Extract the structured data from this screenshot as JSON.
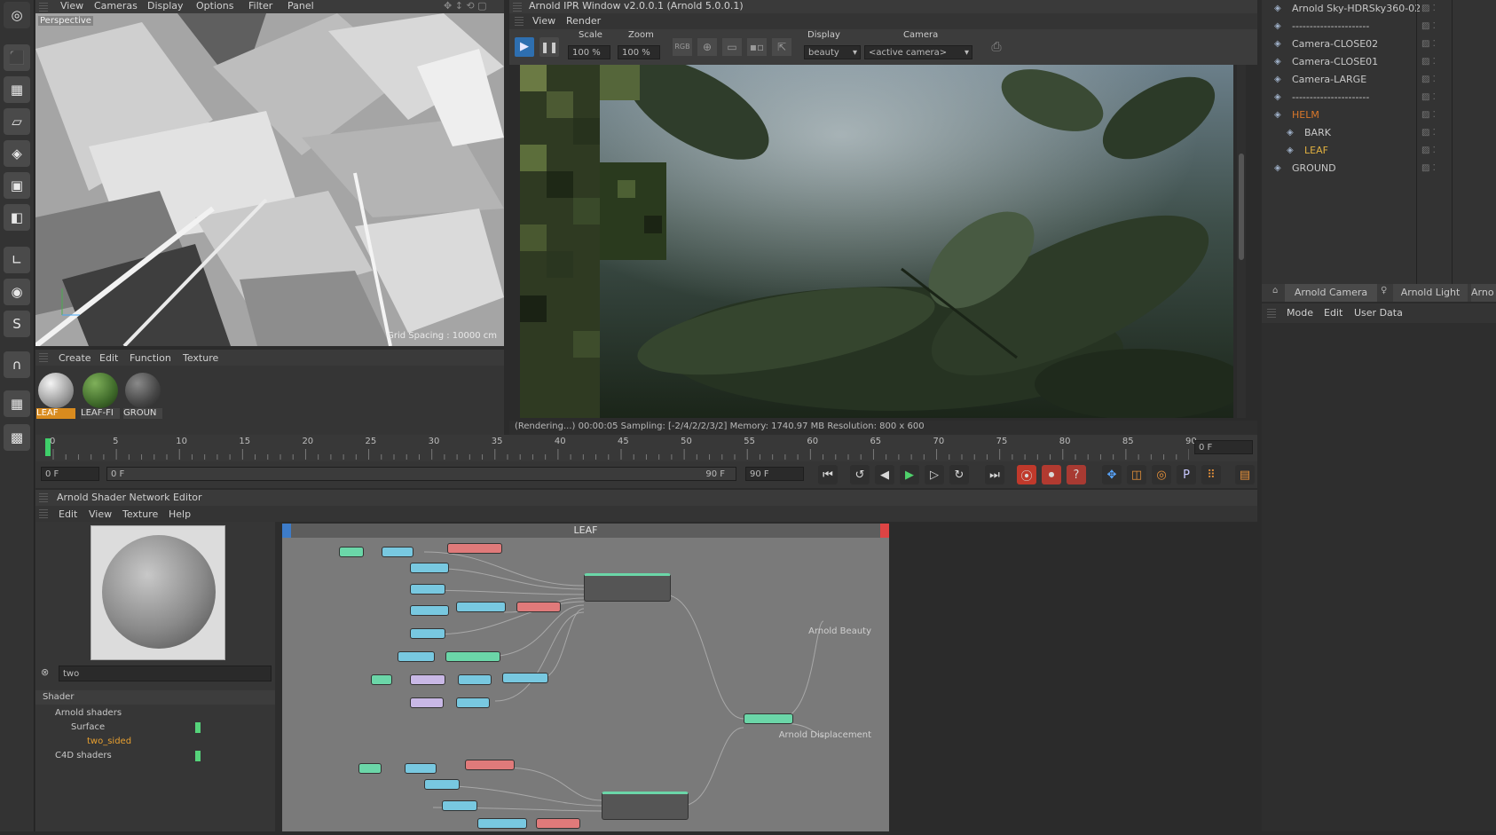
{
  "viewport": {
    "menu": [
      "View",
      "Cameras",
      "Display",
      "Options",
      "Filter",
      "Panel"
    ],
    "label": "Perspective",
    "grid_spacing": "Grid Spacing : 10000 cm"
  },
  "material_manager": {
    "menu": [
      "Create",
      "Edit",
      "Function",
      "Texture"
    ],
    "materials": [
      {
        "name": "LEAF",
        "color": "#cfcfcf",
        "active": true
      },
      {
        "name": "LEAF-FI",
        "color": "#3f6a2a",
        "active": false
      },
      {
        "name": "GROUN",
        "color": "#5a5a5a",
        "active": false
      }
    ]
  },
  "ipr": {
    "title": "Arnold IPR Window v2.0.0.1 (Arnold 5.0.0.1)",
    "menu": [
      "View",
      "Render"
    ],
    "scale_label": "Scale",
    "scale_value": "100 %",
    "zoom_label": "Zoom",
    "zoom_value": "100 %",
    "rgb_label": "RGB",
    "display_label": "Display",
    "display_value": "beauty",
    "camera_label": "Camera",
    "camera_value": "<active camera>",
    "status": "(Rendering...)  00:00:05  Sampling: [-2/4/2/2/3/2]  Memory: 1740.97 MB  Resolution: 800 x 600"
  },
  "timeline": {
    "ticks": [
      "0",
      "5",
      "10",
      "15",
      "20",
      "25",
      "30",
      "35",
      "40",
      "45",
      "50",
      "55",
      "60",
      "65",
      "70",
      "75",
      "80",
      "85",
      "90"
    ],
    "current_frame": "0 F",
    "start_field": "0 F",
    "range_start": "0 F",
    "range_end": "90 F",
    "end_field": "90 F"
  },
  "shader_editor": {
    "title": "Arnold Shader Network Editor",
    "menu": [
      "Edit",
      "View",
      "Texture",
      "Help"
    ],
    "search_value": "two",
    "tree_header": "Shader",
    "tree": [
      {
        "label": "Arnold shaders",
        "level": 0,
        "highlight": false
      },
      {
        "label": "Surface",
        "level": 1,
        "highlight": false
      },
      {
        "label": "two_sided",
        "level": 2,
        "highlight": true
      },
      {
        "label": "C4D shaders",
        "level": 0,
        "highlight": false
      }
    ],
    "canvas_title": "LEAF",
    "port_beauty": "Arnold Beauty",
    "port_displacement": "Arnold Displacement"
  },
  "object_manager": {
    "items": [
      {
        "name": "Arnold Sky-HDRSky360-02",
        "indent": 0,
        "highlight": false
      },
      {
        "name": "----------------------",
        "indent": 0,
        "highlight": false
      },
      {
        "name": "Camera-CLOSE02",
        "indent": 0,
        "highlight": false
      },
      {
        "name": "Camera-CLOSE01",
        "indent": 0,
        "highlight": false
      },
      {
        "name": "Camera-LARGE",
        "indent": 0,
        "highlight": false
      },
      {
        "name": "----------------------",
        "indent": 0,
        "highlight": false
      },
      {
        "name": "HELM",
        "indent": 0,
        "highlight": "orange"
      },
      {
        "name": "BARK",
        "indent": 1,
        "highlight": false
      },
      {
        "name": "LEAF",
        "indent": 1,
        "highlight": "yellow"
      },
      {
        "name": "GROUND",
        "indent": 0,
        "highlight": false
      }
    ]
  },
  "attributes": {
    "tabs": [
      "Arnold Camera",
      "Arnold Light",
      "Arno"
    ],
    "menu": [
      "Mode",
      "Edit",
      "User Data"
    ]
  }
}
